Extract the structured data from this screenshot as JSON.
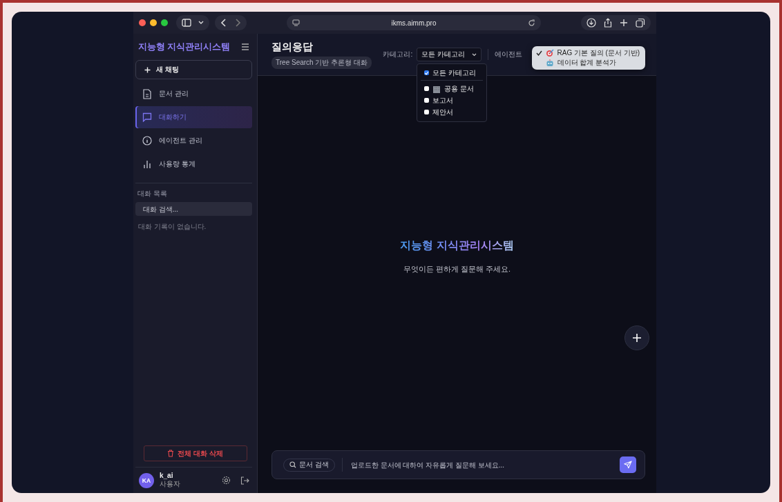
{
  "browser": {
    "address": "ikms.aimm.pro"
  },
  "sidebar": {
    "logo": "지능형 지식관리시스템",
    "new_chat": "새 채팅",
    "nav": [
      {
        "label": "문서 관리",
        "selected": false
      },
      {
        "label": "대화하기",
        "selected": true
      },
      {
        "label": "에이전트 관리",
        "selected": false
      },
      {
        "label": "사용량 통계",
        "selected": false
      }
    ],
    "section_label": "대화 목록",
    "search_placeholder": "대화 검색...",
    "empty_text": "대화 기록이 없습니다.",
    "delete_all": "전체 대화 삭제",
    "user": {
      "initials": "KA",
      "name": "k_ai",
      "role": "사용자"
    }
  },
  "header": {
    "title": "질의응답",
    "subtitle": "Tree Search 기반 추론형 대화",
    "category_label": "카테고리:",
    "category_value": "모든 카테고리",
    "agent_label": "에이전트",
    "category_options": [
      {
        "label": "모든 카테고리",
        "checked": true
      },
      {
        "label": "공용 문서",
        "checked": false
      },
      {
        "label": "보고서",
        "checked": false
      },
      {
        "label": "제안서",
        "checked": false
      }
    ],
    "agent_options": [
      {
        "label": "RAG 기본 질의 (문서 기반)",
        "selected": true
      },
      {
        "label": "데이터 합계 분석가",
        "selected": false
      }
    ]
  },
  "welcome": {
    "title": "지능형 지식관리시스템",
    "subtitle": "무엇이든 편하게 질문해 주세요."
  },
  "composer": {
    "search_button": "문서 검색",
    "placeholder": "업로드한 문서에 대하여 자유롭게 질문해 보세요..."
  }
}
